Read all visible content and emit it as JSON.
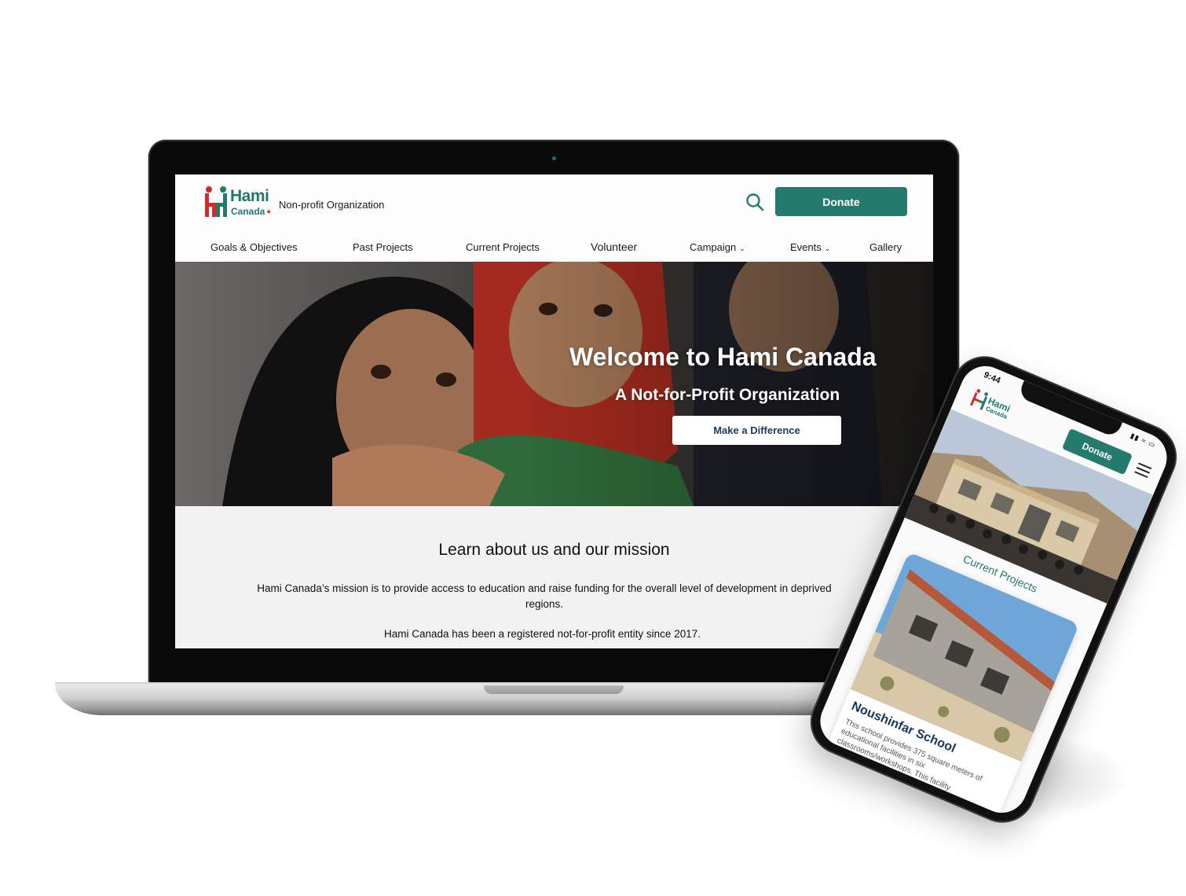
{
  "colors": {
    "brand_green": "#247a6c",
    "brand_red": "#d42a2a",
    "cta_text": "#1c3a5e"
  },
  "laptop": {
    "header": {
      "logo_word": "Hami",
      "logo_sub": "Canada",
      "tagline": "Non-profit Organization",
      "search_icon": "search-icon",
      "donate_label": "Donate"
    },
    "nav": [
      {
        "label": "Goals & Objectives"
      },
      {
        "label": "Past Projects"
      },
      {
        "label": "Current Projects"
      },
      {
        "label": "Volunteer"
      },
      {
        "label": "Campaign",
        "dropdown": true
      },
      {
        "label": "Events",
        "dropdown": true
      },
      {
        "label": "Gallery"
      }
    ],
    "hero": {
      "title": "Welcome to Hami Canada",
      "subtitle": "A Not-for-Profit Organization",
      "cta_label": "Make a Difference"
    },
    "about": {
      "title": "Learn about us and our mission",
      "paragraph1": "Hami Canada’s mission is to provide access to education and raise funding for the overall level of development in deprived regions.",
      "paragraph2": "Hami Canada has been a registered not-for-profit entity since 2017."
    }
  },
  "phone": {
    "status_time": "9:44",
    "logo_word": "Hami",
    "logo_sub": "Canada",
    "donate_label": "Donate",
    "section_title": "Current Projects",
    "card": {
      "title": "Noushinfar School",
      "text": "This school provides 375 square meters of educational facilities in six classrooms/workshops. This facility"
    }
  }
}
